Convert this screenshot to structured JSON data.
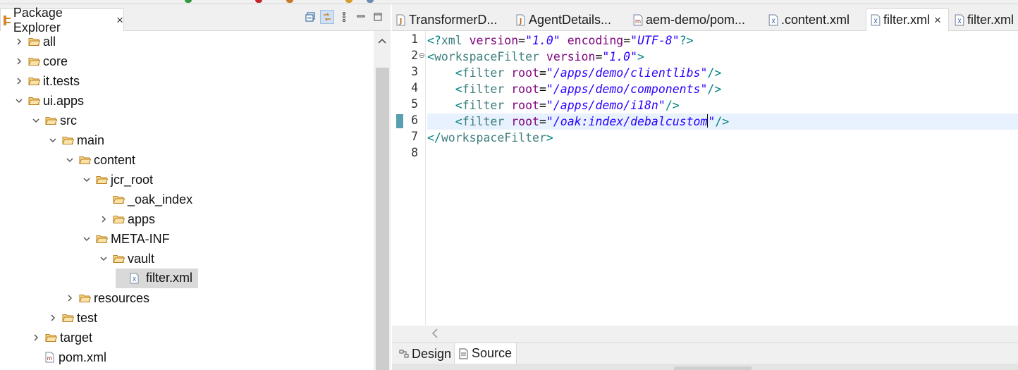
{
  "explorer": {
    "title": "Package Explorer",
    "close": "×",
    "tree": [
      {
        "label": "all",
        "kind": "folder",
        "depth": 0,
        "state": "collapsed"
      },
      {
        "label": "core",
        "kind": "folder",
        "depth": 0,
        "state": "collapsed"
      },
      {
        "label": "it.tests",
        "kind": "folder",
        "depth": 0,
        "state": "collapsed"
      },
      {
        "label": "ui.apps",
        "kind": "folder",
        "depth": 0,
        "state": "expanded"
      },
      {
        "label": "src",
        "kind": "folder",
        "depth": 1,
        "state": "expanded"
      },
      {
        "label": "main",
        "kind": "folder",
        "depth": 2,
        "state": "expanded"
      },
      {
        "label": "content",
        "kind": "folder",
        "depth": 3,
        "state": "expanded"
      },
      {
        "label": "jcr_root",
        "kind": "folder",
        "depth": 4,
        "state": "expanded"
      },
      {
        "label": "_oak_index",
        "kind": "folder",
        "depth": 5,
        "state": "leaf"
      },
      {
        "label": "apps",
        "kind": "folder",
        "depth": 5,
        "state": "collapsed"
      },
      {
        "label": "META-INF",
        "kind": "folder",
        "depth": 4,
        "state": "expanded"
      },
      {
        "label": "vault",
        "kind": "folder",
        "depth": 5,
        "state": "expanded"
      },
      {
        "label": "filter.xml",
        "kind": "xml",
        "depth": 6,
        "state": "leaf",
        "selected": true
      },
      {
        "label": "resources",
        "kind": "folder",
        "depth": 3,
        "state": "collapsed"
      },
      {
        "label": "test",
        "kind": "folder",
        "depth": 2,
        "state": "collapsed"
      },
      {
        "label": "target",
        "kind": "folder",
        "depth": 1,
        "state": "collapsed"
      },
      {
        "label": "pom.xml",
        "kind": "pom",
        "depth": 1,
        "state": "leaf"
      }
    ]
  },
  "editor": {
    "tabs": [
      {
        "label": "TransformerD...",
        "icon": "java-file-icon",
        "active": false
      },
      {
        "label": "AgentDetails...",
        "icon": "java-file-icon",
        "active": false
      },
      {
        "label": "aem-demo/pom...",
        "icon": "maven-pom-icon",
        "active": false
      },
      {
        "label": ".content.xml",
        "icon": "xml-file-icon",
        "active": false
      },
      {
        "label": "filter.xml",
        "icon": "xml-file-icon",
        "active": true,
        "close": "×"
      },
      {
        "label": "filter.xml",
        "icon": "xml-file-icon",
        "active": false
      }
    ],
    "line_numbers": [
      "1",
      "2",
      "3",
      "4",
      "5",
      "6",
      "7",
      "8"
    ],
    "fold_marker": "⊖",
    "current_line": 6,
    "lines": [
      [
        [
          "punct",
          "<?"
        ],
        [
          "tag",
          "xml "
        ],
        [
          "attr",
          "version"
        ],
        [
          "eq",
          "="
        ],
        [
          "val",
          "\"1.0\""
        ],
        [
          "tag",
          " "
        ],
        [
          "attr",
          "encoding"
        ],
        [
          "eq",
          "="
        ],
        [
          "val",
          "\"UTF-8\""
        ],
        [
          "punct",
          "?>"
        ]
      ],
      [
        [
          "punct",
          "<"
        ],
        [
          "tag",
          "workspaceFilter "
        ],
        [
          "attr",
          "version"
        ],
        [
          "eq",
          "="
        ],
        [
          "val",
          "\"1.0\""
        ],
        [
          "punct",
          ">"
        ]
      ],
      [
        [
          "tag",
          "    "
        ],
        [
          "punct",
          "<"
        ],
        [
          "tag",
          "filter "
        ],
        [
          "attr",
          "root"
        ],
        [
          "eq",
          "="
        ],
        [
          "val",
          "\"/apps/demo/clientlibs\""
        ],
        [
          "punct",
          "/>"
        ]
      ],
      [
        [
          "tag",
          "    "
        ],
        [
          "punct",
          "<"
        ],
        [
          "tag",
          "filter "
        ],
        [
          "attr",
          "root"
        ],
        [
          "eq",
          "="
        ],
        [
          "val",
          "\"/apps/demo/components\""
        ],
        [
          "punct",
          "/>"
        ]
      ],
      [
        [
          "tag",
          "    "
        ],
        [
          "punct",
          "<"
        ],
        [
          "tag",
          "filter "
        ],
        [
          "attr",
          "root"
        ],
        [
          "eq",
          "="
        ],
        [
          "val",
          "\"/apps/demo/i18n\""
        ],
        [
          "punct",
          "/>"
        ]
      ],
      [
        [
          "tag",
          "    "
        ],
        [
          "punct",
          "<"
        ],
        [
          "tag",
          "filter "
        ],
        [
          "attr",
          "root"
        ],
        [
          "eq",
          "="
        ],
        [
          "val",
          "\"/oak:index/debalcustom"
        ],
        [
          "caret",
          ""
        ],
        [
          "val",
          "\""
        ],
        [
          "punct",
          "/>"
        ]
      ],
      [
        [
          "punct",
          "</"
        ],
        [
          "tag",
          "workspaceFilter"
        ],
        [
          "punct",
          ">"
        ]
      ],
      []
    ],
    "bottom_tabs": [
      {
        "label": "Design",
        "icon": "design-icon",
        "active": false
      },
      {
        "label": "Source",
        "icon": "source-icon",
        "active": true
      }
    ]
  },
  "colors": {
    "selection": "#d9d9d9",
    "current_line": "#e8f2fe",
    "folder": "#e8b34a",
    "xml_tag": "#3f7f7f",
    "xml_attr": "#7f007f",
    "xml_value": "#2a00ff"
  }
}
